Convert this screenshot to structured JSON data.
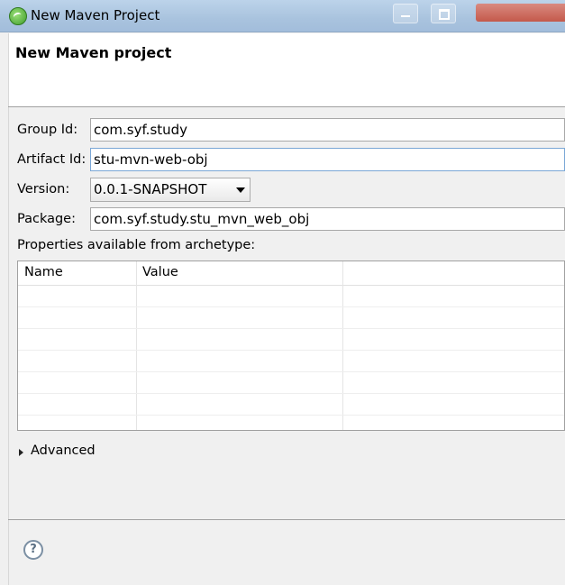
{
  "window": {
    "title": "New Maven Project"
  },
  "header": {
    "title": "New Maven project"
  },
  "form": {
    "group_id": {
      "label": "Group Id:",
      "value": "com.syf.study"
    },
    "artifact_id": {
      "label": "Artifact Id:",
      "value": "stu-mvn-web-obj"
    },
    "version": {
      "label": "Version:",
      "value": "0.0.1-SNAPSHOT"
    },
    "package": {
      "label": "Package:",
      "value": "com.syf.study.stu_mvn_web_obj"
    }
  },
  "properties": {
    "label": "Properties available from archetype:",
    "columns": [
      "Name",
      "Value"
    ],
    "rows": []
  },
  "advanced": {
    "label": "Advanced"
  },
  "footer": {
    "help_icon": "?"
  }
}
